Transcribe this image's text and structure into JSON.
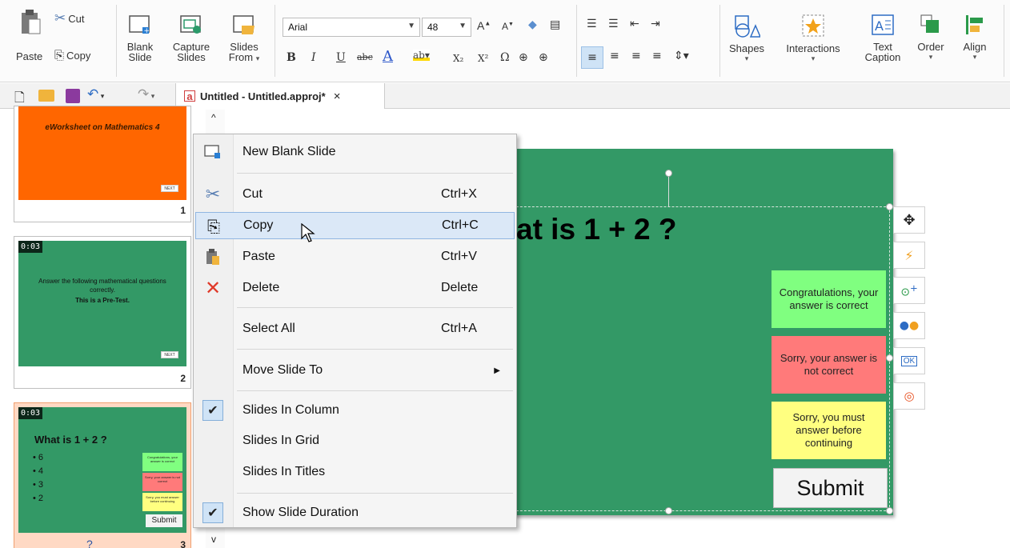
{
  "ribbon": {
    "clipboard": {
      "paste": "Paste",
      "cut": "Cut",
      "copy": "Copy"
    },
    "slides": {
      "blank_line1": "Blank",
      "blank_line2": "Slide",
      "capture_line1": "Capture",
      "capture_line2": "Slides",
      "from_line1": "Slides",
      "from_line2": "From"
    },
    "font": {
      "family": "Arial",
      "size": "48"
    },
    "format": {
      "bold": "B",
      "italic": "I",
      "underline": "U",
      "strike": "abc",
      "font_color": "A",
      "subscript": "X₂",
      "superscript": "X²",
      "omega": "Ω"
    },
    "insert": {
      "shapes": "Shapes",
      "interactions": "Interactions",
      "text_caption_line1": "Text",
      "text_caption_line2": "Caption",
      "order": "Order",
      "align": "Align"
    }
  },
  "document_tab": {
    "title": "Untitled - Untitled.approj*",
    "close": "×"
  },
  "thumbnails": [
    {
      "number": "1",
      "title": "eWorksheet on Mathematics 4",
      "next": "NEXT"
    },
    {
      "number": "2",
      "duration": "0:03",
      "line1": "Answer the following mathematical questions correctly.",
      "line2": "This is a Pre-Test.",
      "next": "NEXT"
    },
    {
      "number": "3",
      "duration": "0:03",
      "question": "What is 1 + 2 ?",
      "options": [
        "6",
        "4",
        "3",
        "2"
      ],
      "captions": [
        "Congratulations, your answer is correct",
        "Sorry, your answer is not correct",
        "Sorry, you must answer before continuing"
      ],
      "submit": "Submit",
      "label": "?"
    }
  ],
  "slide": {
    "question": "at is 1 + 2 ?",
    "captions": {
      "correct": "Congratulations, your answer is correct",
      "incorrect": "Sorry, your answer is not correct",
      "incomplete": "Sorry, you must answer before continuing"
    },
    "submit": "Submit",
    "colors": {
      "slide_bg": "#339966",
      "correct": "#80ff80",
      "incorrect": "#ff7a7a",
      "incomplete": "#ffff80"
    }
  },
  "side_tools": [
    "move-icon",
    "lightning-icon",
    "add-event-icon",
    "feedback-icon",
    "ok-button-icon",
    "action-icon"
  ],
  "side_tools_ok_label": "OK",
  "context_menu": {
    "new_blank_slide": "New Blank Slide",
    "cut": "Cut",
    "cut_key": "Ctrl+X",
    "copy": "Copy",
    "copy_key": "Ctrl+C",
    "paste": "Paste",
    "paste_key": "Ctrl+V",
    "delete": "Delete",
    "delete_key": "Delete",
    "select_all": "Select All",
    "select_all_key": "Ctrl+A",
    "move_slide_to": "Move Slide To",
    "slides_in_column": "Slides In Column",
    "slides_in_grid": "Slides In Grid",
    "slides_in_titles": "Slides In Titles",
    "show_slide_duration": "Show Slide Duration",
    "checked": [
      "Slides In Column",
      "Show Slide Duration"
    ],
    "highlighted": "Copy"
  }
}
